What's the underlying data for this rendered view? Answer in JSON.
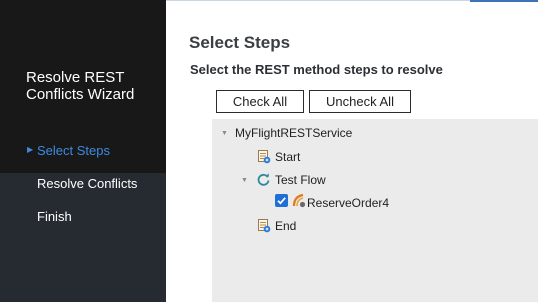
{
  "wizard": {
    "title": "Resolve REST\nConflicts Wizard",
    "steps": [
      {
        "label": "Select Steps",
        "marker": "▶"
      },
      {
        "label": "Resolve Conflicts"
      },
      {
        "label": "Finish"
      }
    ]
  },
  "page": {
    "title": "Select Steps",
    "subtitle": "Select the REST method steps to resolve"
  },
  "buttons": {
    "check_all": "Check All",
    "uncheck_all": "Uncheck All"
  },
  "tree": {
    "root": {
      "label": "MyFlightRESTService",
      "expanded": true
    },
    "start": {
      "label": "Start",
      "icon": "step-icon"
    },
    "test_flow": {
      "label": "Test Flow",
      "icon": "refresh-flow-icon",
      "expanded": true
    },
    "reserve_order": {
      "label": "ReserveOrder4",
      "icon": "rest-method-icon",
      "checked": true
    },
    "end": {
      "label": "End",
      "icon": "step-icon"
    }
  },
  "colors": {
    "active_step": "#3e8ae0",
    "checkbox": "#1f6fd6"
  }
}
